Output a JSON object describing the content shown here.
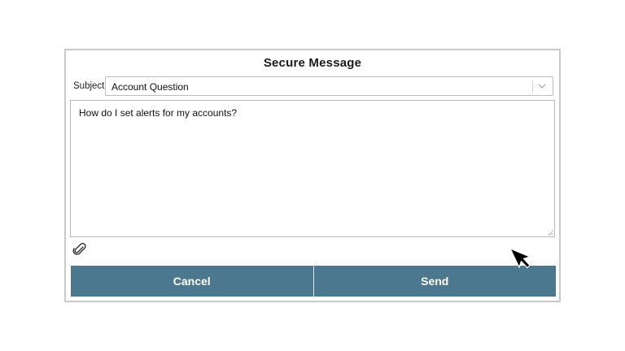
{
  "dialog": {
    "title": "Secure Message",
    "subject_label": "Subject",
    "subject_value": "Account Question",
    "message": "How do I set alerts for my accounts?",
    "cancel_label": "Cancel",
    "send_label": "Send"
  },
  "icons": {
    "attach": "paperclip-icon",
    "dropdown": "chevron-down-icon",
    "pointer": "mouse-cursor-icon"
  },
  "colors": {
    "button_bg": "#4b788e",
    "button_text": "#ffffff",
    "border": "#c9c9c9"
  }
}
